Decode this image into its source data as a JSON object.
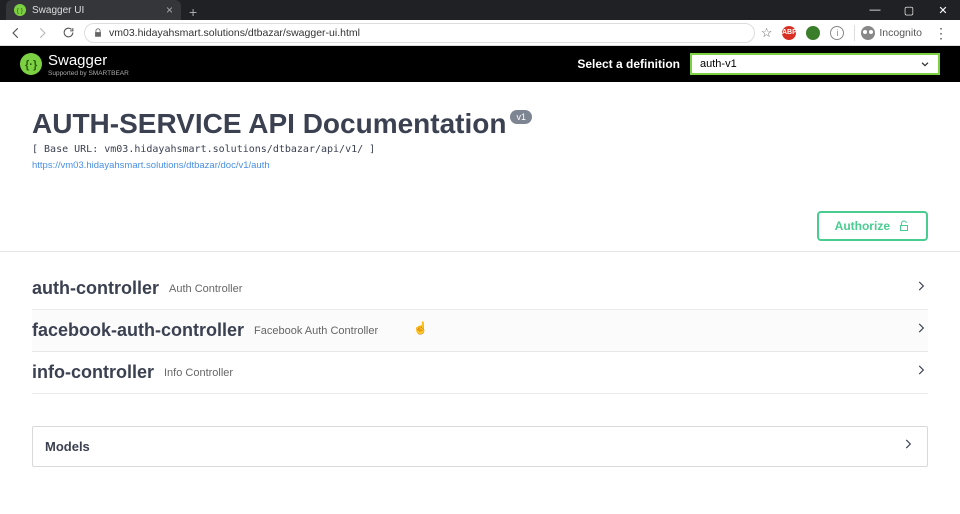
{
  "browser": {
    "tab_title": "Swagger UI",
    "new_tab_label": "+",
    "url": "vm03.hidayahsmart.solutions/dtbazar/swagger-ui.html",
    "star_label": "☆",
    "incognito_label": "Incognito",
    "menu_label": "⋮",
    "abp_label": "ABP",
    "info_label": "i",
    "window_min": "—",
    "window_max": "▢",
    "window_close": "✕"
  },
  "header": {
    "brand": "Swagger",
    "brand_sub": "Supported by SMARTBEAR",
    "definition_label": "Select a definition",
    "definition_selected": "auth-v1"
  },
  "info": {
    "title": "AUTH-SERVICE API Documentation",
    "version": "v1",
    "base_url": "[ Base URL: vm03.hidayahsmart.solutions/dtbazar/api/v1/ ]",
    "doc_url": "https://vm03.hidayahsmart.solutions/dtbazar/doc/v1/auth"
  },
  "authorize_label": "Authorize",
  "tags": [
    {
      "name": "auth-controller",
      "desc": "Auth Controller"
    },
    {
      "name": "facebook-auth-controller",
      "desc": "Facebook Auth Controller"
    },
    {
      "name": "info-controller",
      "desc": "Info Controller"
    }
  ],
  "models_label": "Models"
}
